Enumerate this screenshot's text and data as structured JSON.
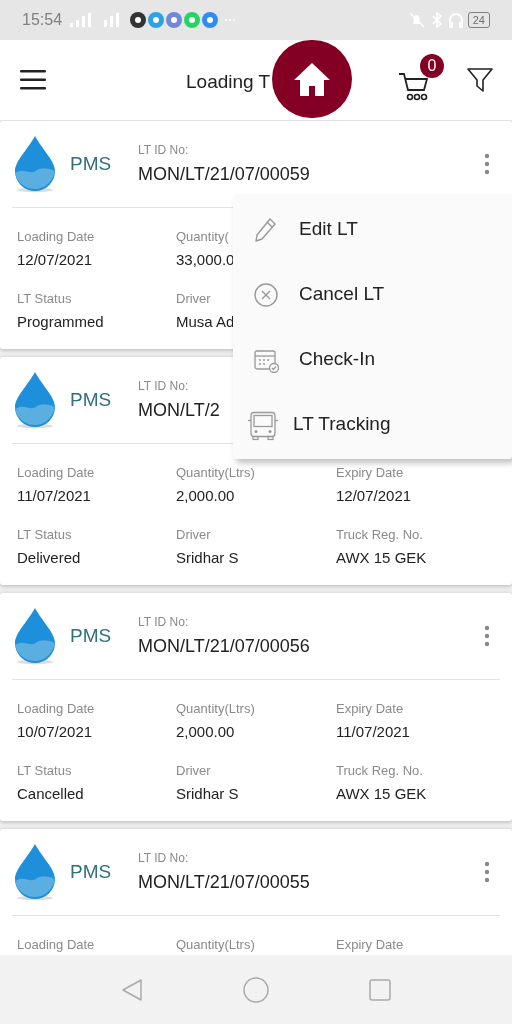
{
  "status_bar": {
    "time": "15:54",
    "battery": "24"
  },
  "header": {
    "title": "Loading T",
    "cart_count": "0"
  },
  "cards": [
    {
      "product": "PMS",
      "id_label": "LT ID No:",
      "id": "MON/LT/21/07/00059",
      "options_icon": true,
      "rows": [
        [
          {
            "label": "Loading Date",
            "value": "12/07/2021"
          },
          {
            "label": "Quantity(",
            "value": "33,000.0"
          }
        ],
        [
          {
            "label": "LT Status",
            "value": "Programmed"
          },
          {
            "label": "Driver",
            "value": "Musa Ad"
          }
        ]
      ]
    },
    {
      "product": "PMS",
      "id_label": "LT ID No:",
      "id": "MON/LT/2",
      "rows": [
        [
          {
            "label": "Loading Date",
            "value": "11/07/2021"
          },
          {
            "label": "Quantity(Ltrs)",
            "value": "2,000.00"
          },
          {
            "label": "Expiry Date",
            "value": "12/07/2021"
          }
        ],
        [
          {
            "label": "LT Status",
            "value": "Delivered"
          },
          {
            "label": "Driver",
            "value": "Sridhar S"
          },
          {
            "label": "Truck Reg. No.",
            "value": "AWX 15 GEK"
          }
        ]
      ]
    },
    {
      "product": "PMS",
      "id_label": "LT ID No:",
      "id": "MON/LT/21/07/00056",
      "options_icon": true,
      "rows": [
        [
          {
            "label": "Loading Date",
            "value": "10/07/2021"
          },
          {
            "label": "Quantity(Ltrs)",
            "value": "2,000.00"
          },
          {
            "label": "Expiry Date",
            "value": "11/07/2021"
          }
        ],
        [
          {
            "label": "LT Status",
            "value": "Cancelled"
          },
          {
            "label": "Driver",
            "value": "Sridhar S"
          },
          {
            "label": "Truck Reg. No.",
            "value": "AWX 15 GEK"
          }
        ]
      ]
    },
    {
      "product": "PMS",
      "id_label": "LT ID No:",
      "id": "MON/LT/21/07/00055",
      "options_icon": true,
      "rows": [
        [
          {
            "label": "Loading Date"
          },
          {
            "label": "Quantity(Ltrs)"
          },
          {
            "label": "Expiry Date"
          }
        ]
      ]
    }
  ],
  "menu": [
    {
      "kind": "edit",
      "label": "Edit LT"
    },
    {
      "kind": "cancel",
      "label": "Cancel LT"
    },
    {
      "kind": "checkin",
      "label": "Check-In"
    },
    {
      "kind": "tracking",
      "label": "LT Tracking"
    }
  ]
}
